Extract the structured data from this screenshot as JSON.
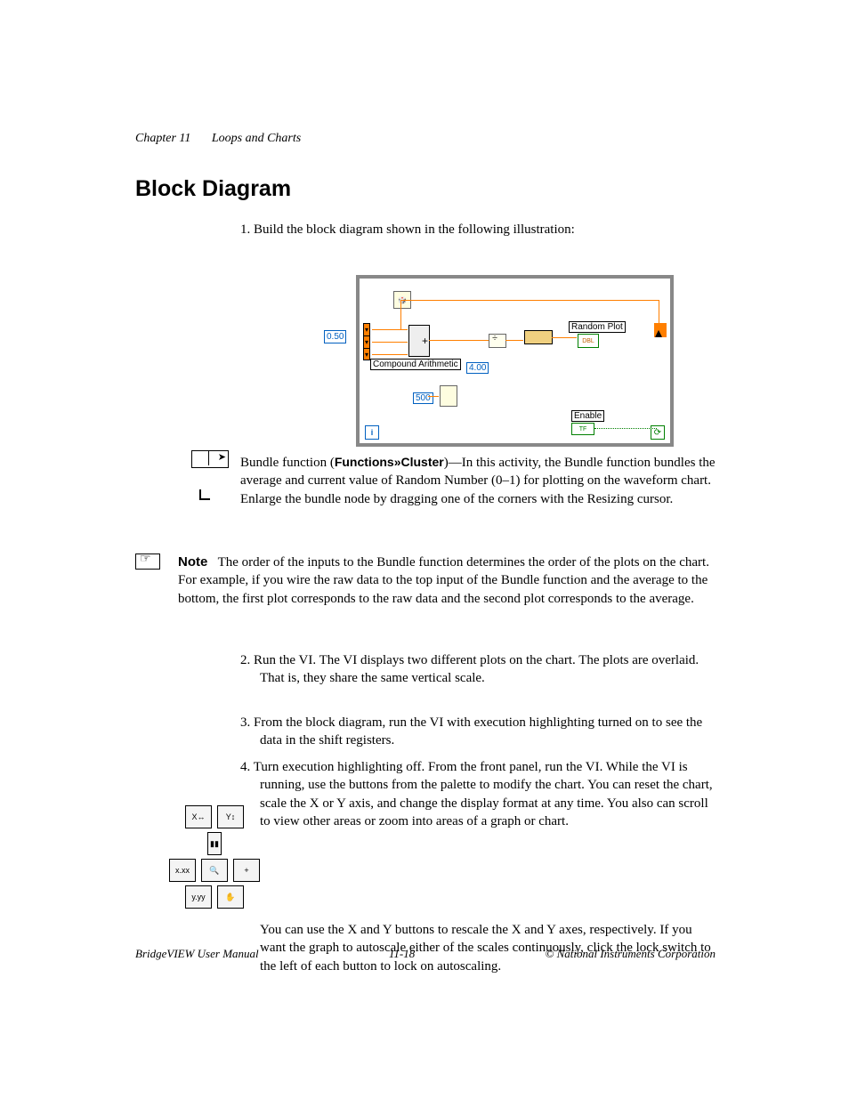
{
  "header": {
    "chapter": "Chapter 11",
    "title": "Loops and Charts"
  },
  "section_heading": "Block Diagram",
  "steps": {
    "s1": "1. Build the block diagram shown in the following illustration:",
    "s2_a": "Bundle function (",
    "s2_b": "Functions»Cluster",
    "s2_c": ")—In this activity, the Bundle function bundles the average and current value of Random Number (0–1) for plotting on the waveform chart. Enlarge the bundle node by dragging one of the corners with the Resizing cursor.",
    "s3": "2. Run the VI. The VI displays two different plots on the chart. The plots are overlaid. That is, they share the same vertical scale.",
    "s4": "3. From the block diagram, run the VI with execution highlighting turned on to see the data in the shift registers.",
    "s5_a": "4. Turn execution highlighting off. From the front panel, run the VI. While the VI is running, use the buttons from the palette to modify the chart. You can reset the chart, scale the X or Y axis, and change the display format at any time. You also can scroll to view other areas or zoom into areas of a graph or chart.",
    "s5_b": "You can use the X and Y buttons to rescale the X and Y axes, respectively. If you want the graph to autoscale either of the scales continuously, click the lock switch to the left of each button to lock on autoscaling.",
    "note_label": "Note",
    "note_body": "The order of the inputs to the Bundle function determines the order of the plots on the chart. For example, if you wire the raw data to the top input of the Bundle function and the average to the bottom, the first plot corresponds to the raw data and the second plot corresponds to the average."
  },
  "diagram": {
    "const_050": "0.50",
    "compound_arithmetic": "Compound Arithmetic",
    "const_4": "4.00",
    "const_500": "500",
    "random_plot": "Random Plot",
    "enable": "Enable",
    "enable_tf": "TF",
    "i": "i",
    "plot_term": "DBL"
  },
  "palette_buttons": {
    "r1a": "X↔",
    "r1b": "Y↕",
    "r2a": "▮▮",
    "r3a": "x.xx",
    "r3b": "🔍",
    "r3c": "+",
    "r4a": "y.yy",
    "r4b": "✋"
  },
  "footer": {
    "left": "BridgeVIEW User Manual",
    "center": "11-18",
    "right": "© National Instruments Corporation"
  }
}
